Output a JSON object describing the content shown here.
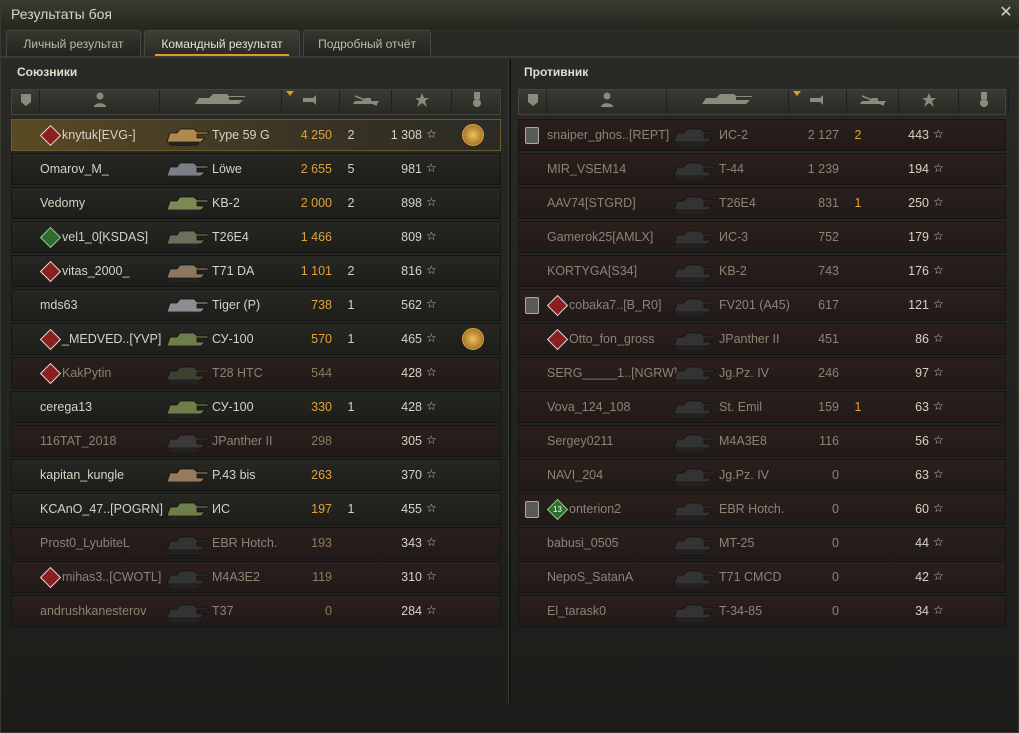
{
  "window": {
    "title": "Результаты боя",
    "close_icon": "close-icon"
  },
  "tabs": [
    {
      "label": "Личный результат",
      "active": false
    },
    {
      "label": "Командный результат",
      "active": true
    },
    {
      "label": "Подробный отчёт",
      "active": false
    }
  ],
  "allies": {
    "title": "Союзники",
    "columns": [
      "platoon-icon",
      "player-icon",
      "tank-icon",
      "damage-icon",
      "kills-icon",
      "xp-star-icon",
      "medal-icon"
    ],
    "rows": [
      {
        "player": "knytuk[EVG-]",
        "tank": "Type 59 G",
        "damage": "4 250",
        "kills": "2",
        "xp": "1 308",
        "alive": true,
        "highlight": true,
        "clan": "red",
        "medal": "2",
        "tank_color": "#b08a4a"
      },
      {
        "player": "Omarov_M_",
        "tank": "Löwe",
        "damage": "2 655",
        "kills": "5",
        "xp": "981",
        "alive": true,
        "tank_color": "#7c7e86"
      },
      {
        "player": "Vedomy",
        "tank": "KB-2",
        "damage": "2 000",
        "kills": "2",
        "xp": "898",
        "alive": true,
        "tank_color": "#7b8a55"
      },
      {
        "player": "vel1_0[KSDAS]",
        "tank": "T26E4",
        "damage": "1 466",
        "kills": "",
        "xp": "809",
        "alive": true,
        "clan": "green",
        "tank_color": "#6f6e58"
      },
      {
        "player": "vitas_2000_",
        "tank": "T71 DA",
        "damage": "1 101",
        "kills": "2",
        "xp": "816",
        "alive": true,
        "clan": "red",
        "tank_color": "#8a7860"
      },
      {
        "player": "mds63",
        "tank": "Tiger (P)",
        "damage": "738",
        "kills": "1",
        "xp": "562",
        "alive": true,
        "tank_color": "#8e8e92"
      },
      {
        "player": "_MEDVED..[YVP]",
        "tank": "СУ-100",
        "damage": "570",
        "kills": "1",
        "xp": "465",
        "alive": true,
        "clan": "red",
        "medal": "",
        "tank_color": "#6e7e4a"
      },
      {
        "player": "KakPytin",
        "tank": "T28 HTC",
        "damage": "544",
        "kills": "",
        "xp": "428",
        "alive": false,
        "clan": "red",
        "tank_color": "#3e4030"
      },
      {
        "player": "cerega13",
        "tank": "СУ-100",
        "damage": "330",
        "kills": "1",
        "xp": "428",
        "alive": true,
        "tank_color": "#6e7e4a"
      },
      {
        "player": "116TAT_2018",
        "tank": "JPanther II",
        "damage": "298",
        "kills": "",
        "xp": "305",
        "alive": false,
        "tank_color": "#3a3a3a"
      },
      {
        "player": "kapitan_kungle",
        "tank": "P.43 bis",
        "damage": "263",
        "kills": "",
        "xp": "370",
        "alive": true,
        "tank_color": "#9a7a58"
      },
      {
        "player": "KCAnO_47..[POGRN]",
        "tank": "ИС",
        "damage": "197",
        "kills": "1",
        "xp": "455",
        "alive": true,
        "tank_color": "#6e7e4a"
      },
      {
        "player": "Prost0_LyubiteL",
        "tank": "EBR Hotch.",
        "damage": "193",
        "kills": "",
        "xp": "343",
        "alive": false,
        "tank_color": "#333"
      },
      {
        "player": "mihas3..[CWOTL]",
        "tank": "M4A3E2",
        "damage": "119",
        "kills": "",
        "xp": "310",
        "alive": false,
        "clan": "red",
        "tank_color": "#333"
      },
      {
        "player": "andrushkanesterov",
        "tank": "T37",
        "damage": "0",
        "kills": "",
        "xp": "284",
        "alive": false,
        "tank_color": "#333"
      }
    ]
  },
  "enemies": {
    "title": "Противник",
    "columns": [
      "platoon-icon",
      "player-icon",
      "tank-icon",
      "damage-icon",
      "kills-icon",
      "xp-star-icon",
      "medal-icon"
    ],
    "rows": [
      {
        "player": "snaiper_ghos..[REPT]",
        "tank": "ИС-2",
        "damage": "2 127",
        "kills": "2",
        "xp": "443",
        "alive": false,
        "platoon": "I",
        "tank_color": "#333"
      },
      {
        "player": "MIR_VSEM14",
        "tank": "T-44",
        "damage": "1 239",
        "kills": "",
        "xp": "194",
        "alive": false,
        "tank_color": "#333"
      },
      {
        "player": "AAV74[STGRD]",
        "tank": "T26E4",
        "damage": "831",
        "kills": "1",
        "xp": "250",
        "alive": false,
        "tank_color": "#333"
      },
      {
        "player": "Gamerok25[AMLX]",
        "tank": "ИС-3",
        "damage": "752",
        "kills": "",
        "xp": "179",
        "alive": false,
        "tank_color": "#333"
      },
      {
        "player": "KORTYGA[S34]",
        "tank": "KB-2",
        "damage": "743",
        "kills": "",
        "xp": "176",
        "alive": false,
        "tank_color": "#333"
      },
      {
        "player": "cobaka7..[B_R0]",
        "tank": "FV201 (A45)",
        "damage": "617",
        "kills": "",
        "xp": "121",
        "alive": false,
        "platoon": "I",
        "clan": "red",
        "tank_color": "#333"
      },
      {
        "player": "Otto_fon_gross",
        "tank": "JPanther II",
        "damage": "451",
        "kills": "",
        "xp": "86",
        "alive": false,
        "clan": "red",
        "tank_color": "#333"
      },
      {
        "player": "SERG_____1..[NGRW]",
        "tank": "Jg.Pz. IV",
        "damage": "246",
        "kills": "",
        "xp": "97",
        "alive": false,
        "tank_color": "#333"
      },
      {
        "player": "Vova_124_108",
        "tank": "St. Emil",
        "damage": "159",
        "kills": "1",
        "xp": "63",
        "alive": false,
        "tank_color": "#333"
      },
      {
        "player": "Sergey0211",
        "tank": "M4A3E8",
        "damage": "116",
        "kills": "",
        "xp": "56",
        "alive": false,
        "tank_color": "#333"
      },
      {
        "player": "NAVI_204",
        "tank": "Jg.Pz. IV",
        "damage": "0",
        "kills": "",
        "xp": "63",
        "alive": false,
        "tank_color": "#333"
      },
      {
        "player": "onterion2",
        "tank": "EBR Hotch.",
        "damage": "0",
        "kills": "",
        "xp": "60",
        "alive": false,
        "platoon": "I",
        "clan": "green",
        "clan_label": "13",
        "tank_color": "#333"
      },
      {
        "player": "babusi_0505",
        "tank": "MT-25",
        "damage": "0",
        "kills": "",
        "xp": "44",
        "alive": false,
        "tank_color": "#333"
      },
      {
        "player": "NepoS_SatanA",
        "tank": "T71 CMCD",
        "damage": "0",
        "kills": "",
        "xp": "42",
        "alive": false,
        "tank_color": "#333"
      },
      {
        "player": "El_tarask0",
        "tank": "T-34-85",
        "damage": "0",
        "kills": "",
        "xp": "34",
        "alive": false,
        "tank_color": "#333"
      }
    ]
  }
}
